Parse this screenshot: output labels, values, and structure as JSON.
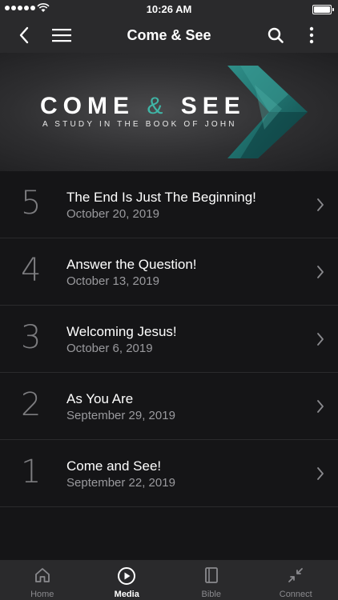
{
  "status_bar": {
    "time": "10:26 AM"
  },
  "header": {
    "title": "Come & See"
  },
  "banner": {
    "title_left": "COME",
    "title_amp": "&",
    "title_right": "SEE",
    "subtitle": "A STUDY IN THE BOOK OF JOHN",
    "accent_color": "#3fb6a7"
  },
  "sermons": [
    {
      "number": "5",
      "title": "The End Is Just The Beginning!",
      "date": "October 20, 2019"
    },
    {
      "number": "4",
      "title": "Answer the Question!",
      "date": "October 13, 2019"
    },
    {
      "number": "3",
      "title": "Welcoming Jesus!",
      "date": "October 6, 2019"
    },
    {
      "number": "2",
      "title": "As You Are",
      "date": "September 29, 2019"
    },
    {
      "number": "1",
      "title": "Come and See!",
      "date": "September 22, 2019"
    }
  ],
  "tabs": [
    {
      "label": "Home",
      "icon": "home-icon",
      "active": false
    },
    {
      "label": "Media",
      "icon": "play-icon",
      "active": true
    },
    {
      "label": "Bible",
      "icon": "book-icon",
      "active": false
    },
    {
      "label": "Connect",
      "icon": "connect-icon",
      "active": false
    }
  ]
}
